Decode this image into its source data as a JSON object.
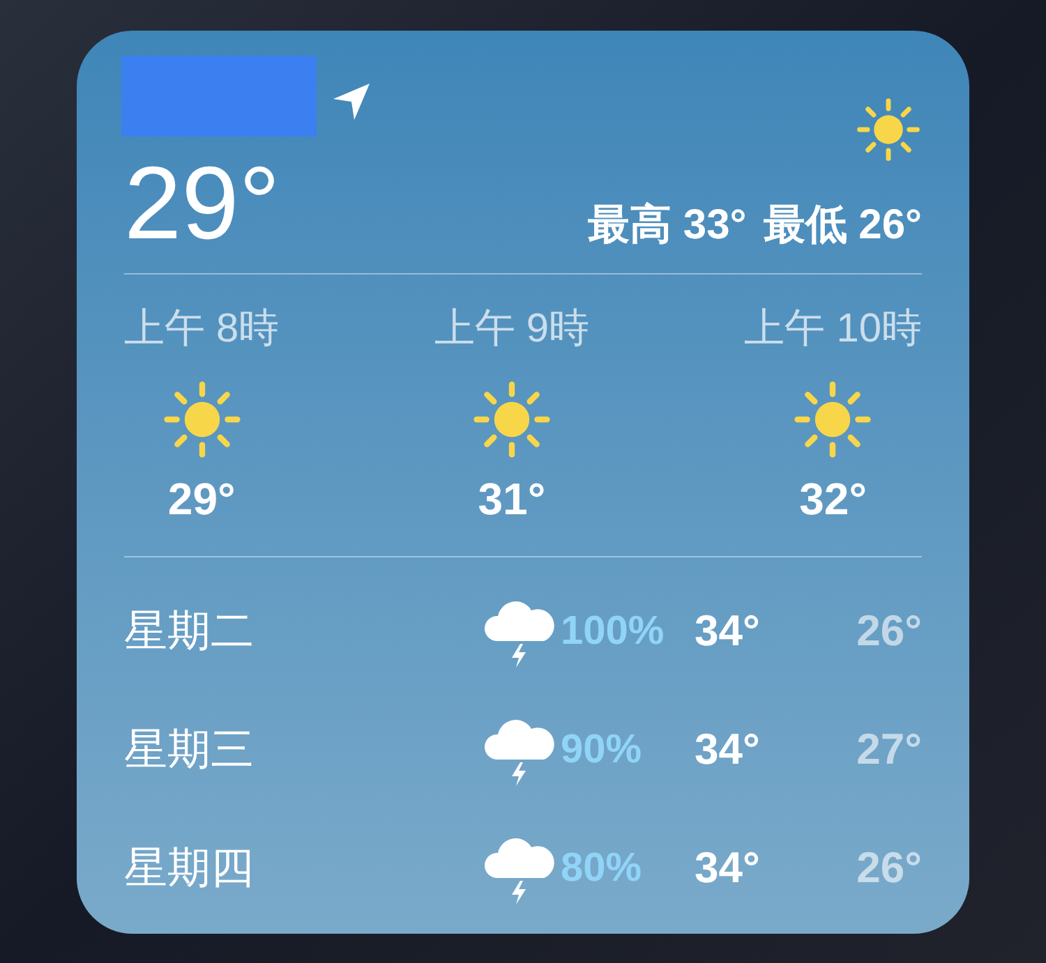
{
  "current": {
    "temp": "29°",
    "kind": "sunny",
    "high": "最高 33°",
    "low": "最低 26°"
  },
  "hourly": [
    {
      "time": "上午 8時",
      "kind": "sunny",
      "temp": "29°"
    },
    {
      "time": "上午 9時",
      "kind": "sunny",
      "temp": "31°"
    },
    {
      "time": "上午 10時",
      "kind": "sunny",
      "temp": "32°"
    }
  ],
  "daily": [
    {
      "day": "星期二",
      "kind": "thunderstorm",
      "precip": "100%",
      "high": "34°",
      "low": "26°"
    },
    {
      "day": "星期三",
      "kind": "thunderstorm",
      "precip": "90%",
      "high": "34°",
      "low": "27°"
    },
    {
      "day": "星期四",
      "kind": "thunderstorm",
      "precip": "80%",
      "high": "34°",
      "low": "26°"
    }
  ]
}
